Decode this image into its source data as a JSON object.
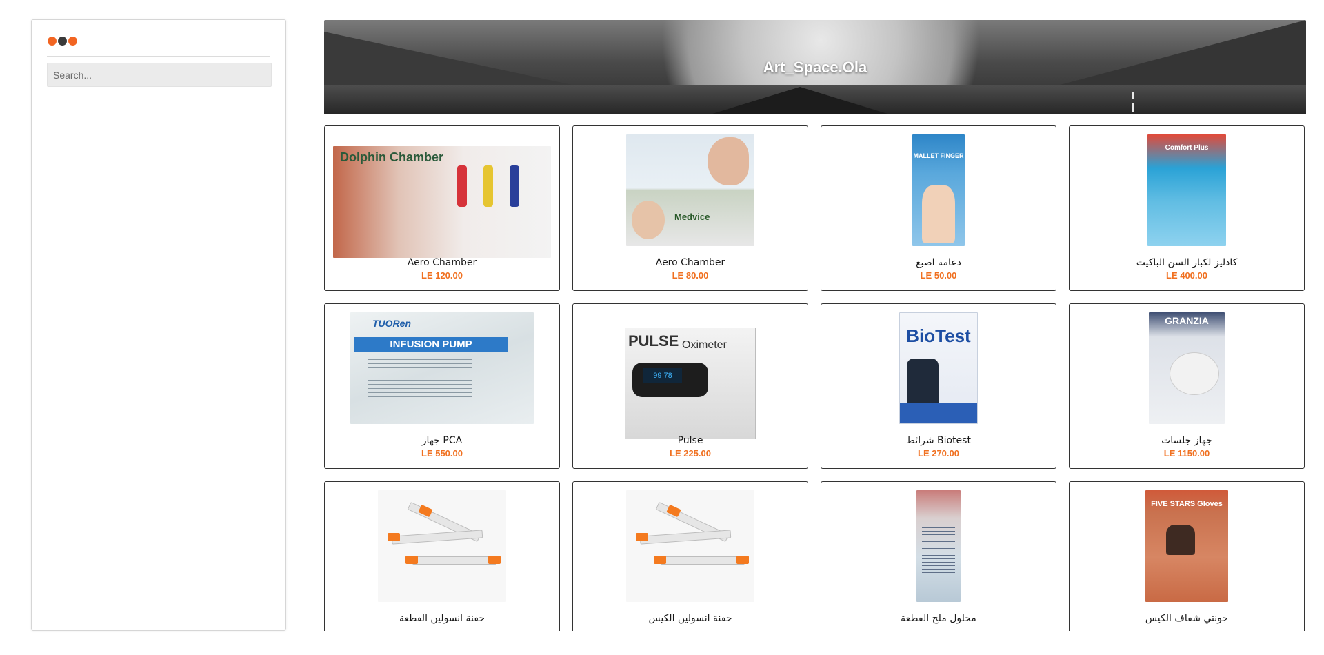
{
  "sidebar": {
    "dots_colors": [
      "#f26522",
      "#3a3a3a",
      "#f26522"
    ],
    "search": {
      "placeholder": "Search...",
      "value": ""
    }
  },
  "banner": {
    "title": "Art_Space.Ola"
  },
  "products": [
    {
      "name": "Aero Chamber",
      "price": "LE 120.00",
      "image": "dolphin-chamber",
      "image_text": "Dolphin Chamber"
    },
    {
      "name": "Aero Chamber",
      "price": "LE 80.00",
      "image": "medvice-chamber",
      "image_text": "Medvice"
    },
    {
      "name": "دعامة اصبع",
      "price": "LE 50.00",
      "image": "mallet-finger",
      "image_text": "MALLET FINGER"
    },
    {
      "name": "كادليز لكبار السن الباكيت",
      "price": "LE 400.00",
      "image": "adult-diapers",
      "image_text": "Comfort Plus"
    },
    {
      "name": "جهاز PCA",
      "price": "LE 550.00",
      "image": "infusion-pump",
      "image_text": "INFUSION PUMP"
    },
    {
      "name": "Pulse",
      "price": "LE 225.00",
      "image": "pulse-oximeter",
      "image_text": "PULSE Oximeter"
    },
    {
      "name": "شرائط Biotest",
      "price": "LE 270.00",
      "image": "biotest-strips",
      "image_text": "BioTest"
    },
    {
      "name": "جهاز جلسات",
      "price": "LE 1150.00",
      "image": "granzia-nebulizer",
      "image_text": "GRANZIA"
    },
    {
      "name": "حقنة انسولين القطعة",
      "price": "",
      "image": "insulin-syringes"
    },
    {
      "name": "حقنة انسولين الكيس",
      "price": "",
      "image": "insulin-syringes"
    },
    {
      "name": "محلول ملح القطعة",
      "price": "",
      "image": "saline-bottle"
    },
    {
      "name": "جونتي شفاف الكيس",
      "price": "",
      "image": "gloves-box",
      "image_text": "FIVE STARS Gloves"
    }
  ]
}
